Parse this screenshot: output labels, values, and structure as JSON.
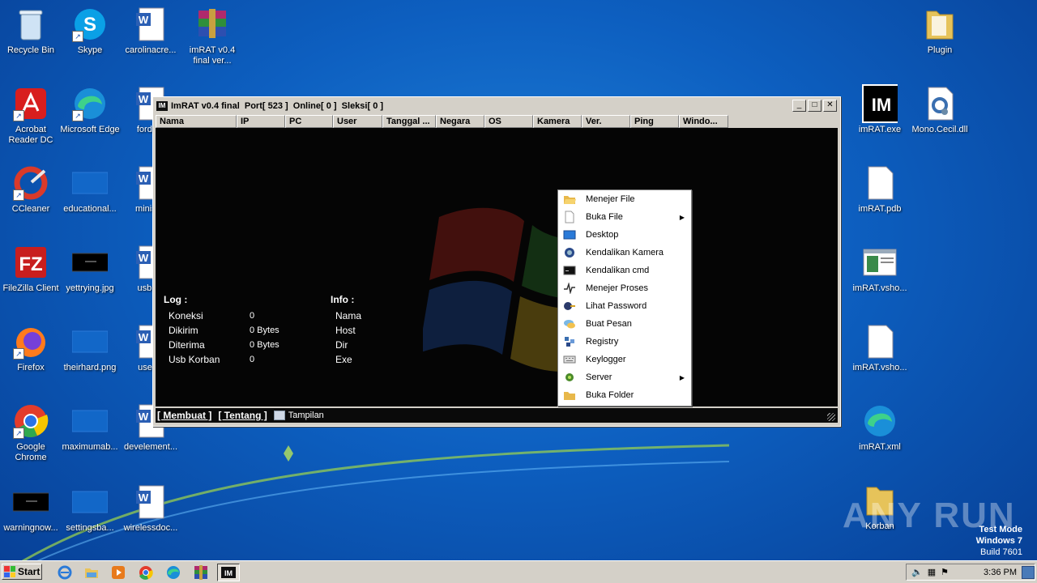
{
  "desktop": {
    "icons_left": [
      {
        "label": "Recycle Bin"
      },
      {
        "label": "Skype"
      },
      {
        "label": "carolinacre..."
      },
      {
        "label": "imRAT v0.4 final ver..."
      },
      {
        "label": "Acrobat Reader DC"
      },
      {
        "label": "Microsoft Edge"
      },
      {
        "label": "fordme"
      },
      {
        "label": "CCleaner"
      },
      {
        "label": "educational..."
      },
      {
        "label": "minisho"
      },
      {
        "label": "FileZilla Client"
      },
      {
        "label": "yettrying.jpg"
      },
      {
        "label": "usbres"
      },
      {
        "label": "Firefox"
      },
      {
        "label": "theirhard.png"
      },
      {
        "label": "usefull"
      },
      {
        "label": "Google Chrome"
      },
      {
        "label": "maximumab..."
      },
      {
        "label": "develement..."
      },
      {
        "label": "warningnow..."
      },
      {
        "label": "settingsba..."
      },
      {
        "label": "wirelessdoc..."
      }
    ],
    "icons_right": [
      {
        "label": "Plugin"
      },
      {
        "label": "imRAT.exe"
      },
      {
        "label": "Mono.Cecil.dll"
      },
      {
        "label": "imRAT.pdb"
      },
      {
        "label": "imRAT.vsho..."
      },
      {
        "label": "imRAT.vsho..."
      },
      {
        "label": "imRAT.xml"
      },
      {
        "label": "Korban"
      }
    ]
  },
  "window": {
    "title": "ImRAT v0.4 final  Port[ 523 ]  Online[ 0 ]  Sleksi[ 0 ]",
    "app_icon_text": "IM",
    "columns": [
      "Nama",
      "IP",
      "PC",
      "User",
      "Tanggal ...",
      "Negara",
      "OS",
      "Kamera",
      "Ver.",
      "Ping",
      "Windo..."
    ],
    "log": {
      "title": "Log :",
      "rows": [
        {
          "key": "Koneksi",
          "value": "0"
        },
        {
          "key": "Dikirim",
          "value": "0 Bytes"
        },
        {
          "key": "Diterima",
          "value": "0 Bytes"
        },
        {
          "key": "Usb Korban",
          "value": "0"
        }
      ]
    },
    "info": {
      "title": "Info :",
      "rows": [
        "Nama",
        "Host",
        "Dir",
        "Exe"
      ]
    },
    "status": {
      "link1": "[ Membuat ]",
      "link2": "[ Tentang ]",
      "view_label": "Tampilan"
    }
  },
  "context_menu": {
    "items": [
      {
        "label": "Menejer File",
        "icon": "folder-open-icon",
        "submenu": false
      },
      {
        "label": "Buka File",
        "icon": "file-icon",
        "submenu": true
      },
      {
        "label": "Desktop",
        "icon": "desktop-icon",
        "submenu": false
      },
      {
        "label": "Kendalikan Kamera",
        "icon": "webcam-icon",
        "submenu": false
      },
      {
        "label": "Kendalikan cmd",
        "icon": "cmd-icon",
        "submenu": false
      },
      {
        "label": "Menejer Proses",
        "icon": "process-icon",
        "submenu": false
      },
      {
        "label": "Lihat Password",
        "icon": "password-icon",
        "submenu": false
      },
      {
        "label": "Buat Pesan",
        "icon": "message-icon",
        "submenu": false
      },
      {
        "label": "Registry",
        "icon": "registry-icon",
        "submenu": false
      },
      {
        "label": "Keylogger",
        "icon": "keyboard-icon",
        "submenu": false
      },
      {
        "label": "Server",
        "icon": "server-icon",
        "submenu": true
      },
      {
        "label": "Buka Folder",
        "icon": "folder-icon",
        "submenu": false
      }
    ]
  },
  "taskbar": {
    "start_label": "Start",
    "clock": "3:36 PM"
  },
  "watermark": {
    "line1": "Test Mode",
    "line2": "Windows 7",
    "line3": "Build 7601"
  },
  "anyrun": "ANY RUN"
}
